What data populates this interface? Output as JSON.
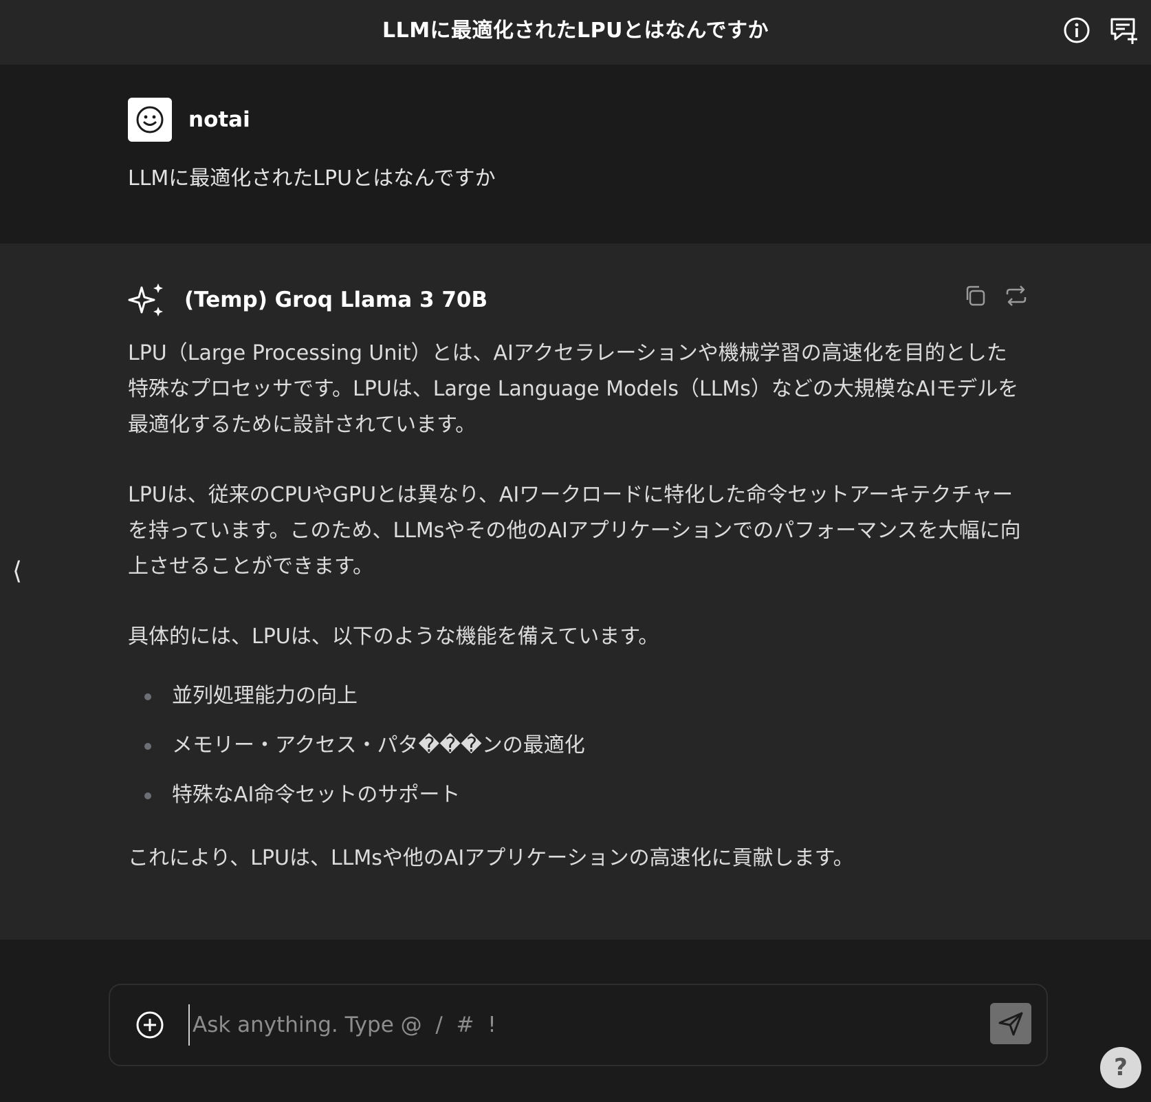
{
  "header": {
    "title": "LLMに最適化されたLPUとはなんですか",
    "icons": [
      "info-icon",
      "new-chat-icon"
    ]
  },
  "user_message": {
    "author": "notai",
    "avatar_icon": "smiley-face-icon",
    "text": "LLMに最適化されたLPUとはなんですか"
  },
  "bot_message": {
    "model": "(Temp) Groq Llama 3 70B",
    "model_icon": "sparkles-icon",
    "actions": [
      "copy-icon",
      "regenerate-icon"
    ],
    "paragraphs": [
      "LPU（Large Processing Unit）とは、AIアクセラレーションや機械学習の高速化を目的とした特殊なプロセッサです。LPUは、Large Language Models（LLMs）などの大規模なAIモデルを最適化するために設計されています。",
      "LPUは、従来のCPUやGPUとは異なり、AIワークロードに特化した命令セットアーキテクチャーを持っています。このため、LLMsやその他のAIアプリケーションでのパフォーマンスを大幅に向上させることができます。",
      "具体的には、LPUは、以下のような機能を備えています。"
    ],
    "bullets": [
      "並列処理能力の向上",
      "メモリー・アクセス・パタ���ンの最適化",
      "特殊なAI命令セットのサポート"
    ],
    "final": "これにより、LPUは、LLMsや他のAIアプリケーションの高速化に貢献します。"
  },
  "sidebar_toggle": "⟨",
  "composer": {
    "placeholder": "Ask anything. Type @  /  #  !",
    "value": "",
    "add_icon": "plus-circle-icon",
    "send_icon": "send-icon"
  },
  "help": {
    "label": "?"
  },
  "colors": {
    "background": "#1b1b1b",
    "panel": "#262626",
    "send_button": "#6e6e6e"
  }
}
